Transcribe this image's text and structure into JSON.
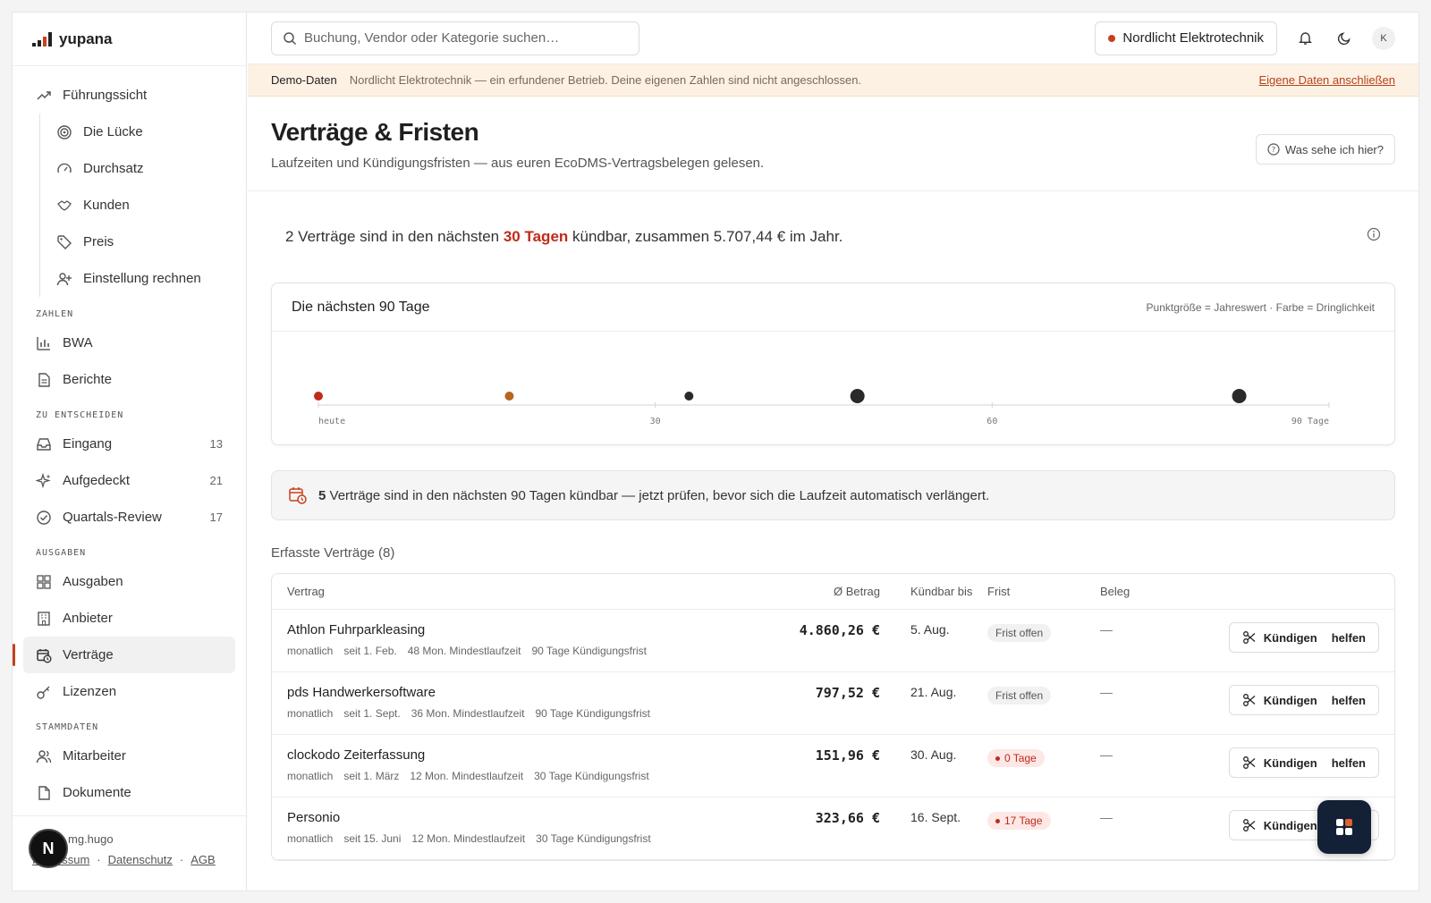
{
  "brand": {
    "name": "yupana"
  },
  "sidebar": {
    "top_items": [
      {
        "label": "Führungssicht",
        "icon": "trend-up-icon"
      }
    ],
    "sub_items": [
      {
        "label": "Die Lücke",
        "icon": "target-icon"
      },
      {
        "label": "Durchsatz",
        "icon": "gauge-icon"
      },
      {
        "label": "Kunden",
        "icon": "handshake-icon"
      },
      {
        "label": "Preis",
        "icon": "tag-icon"
      },
      {
        "label": "Einstellung rechnen",
        "icon": "user-plus-icon"
      }
    ],
    "sections": [
      {
        "title": "ZAHLEN",
        "items": [
          {
            "label": "BWA",
            "icon": "bar-chart-icon",
            "count": ""
          },
          {
            "label": "Berichte",
            "icon": "document-icon",
            "count": ""
          }
        ]
      },
      {
        "title": "ZU ENTSCHEIDEN",
        "items": [
          {
            "label": "Eingang",
            "icon": "inbox-icon",
            "count": "13"
          },
          {
            "label": "Aufgedeckt",
            "icon": "sparkles-icon",
            "count": "21"
          },
          {
            "label": "Quartals-Review",
            "icon": "check-circle-icon",
            "count": "17"
          }
        ]
      },
      {
        "title": "AUSGABEN",
        "items": [
          {
            "label": "Ausgaben",
            "icon": "grid-icon",
            "count": ""
          },
          {
            "label": "Anbieter",
            "icon": "building-icon",
            "count": ""
          },
          {
            "label": "Verträge",
            "icon": "calendar-clock-icon",
            "count": "",
            "active": true
          },
          {
            "label": "Lizenzen",
            "icon": "key-icon",
            "count": ""
          }
        ]
      },
      {
        "title": "STAMMDATEN",
        "items": [
          {
            "label": "Mitarbeiter",
            "icon": "users-icon",
            "count": ""
          },
          {
            "label": "Dokumente",
            "icon": "file-icon",
            "count": ""
          }
        ]
      }
    ],
    "footer": {
      "user": "mg.hugo",
      "links": [
        "Impressum",
        "Datenschutz",
        "AGB"
      ],
      "avatar_letter": "N"
    }
  },
  "topbar": {
    "search_placeholder": "Buchung, Vendor oder Kategorie suchen…",
    "company": "Nordlicht Elektrotechnik",
    "avatar": "K"
  },
  "banner": {
    "label": "Demo-Daten",
    "text": "Nordlicht Elektrotechnik — ein erfundener Betrieb. Deine eigenen Zahlen sind nicht angeschlossen.",
    "link": "Eigene Daten anschließen"
  },
  "page": {
    "title": "Verträge & Fristen",
    "subtitle": "Laufzeiten und Kündigungsfristen — aus euren EcoDMS-Vertragsbelegen gelesen.",
    "help": "Was sehe ich hier?"
  },
  "summary": {
    "prefix": "2 Verträge sind in den nächsten ",
    "highlight": "30 Tagen",
    "suffix": " kündbar, zusammen 5.707,44 € im Jahr."
  },
  "chart_data": {
    "type": "scatter",
    "title": "Die nächsten 90 Tage",
    "legend": "Punktgröße = Jahreswert · Farbe = Dringlichkeit",
    "x_ticks": [
      {
        "value": 0,
        "label": "heute"
      },
      {
        "value": 30,
        "label": "30"
      },
      {
        "value": 60,
        "label": "60"
      },
      {
        "value": 90,
        "label": "90 Tage"
      }
    ],
    "xlim": [
      0,
      90
    ],
    "points": [
      {
        "x": 0,
        "size": 1,
        "color": "#c02a1a"
      },
      {
        "x": 17,
        "size": 1,
        "color": "#b8651e"
      },
      {
        "x": 33,
        "size": 1,
        "color": "#2a2a2a"
      },
      {
        "x": 48,
        "size": 1.6,
        "color": "#2a2a2a"
      },
      {
        "x": 82,
        "size": 1.6,
        "color": "#2a2a2a"
      }
    ]
  },
  "alert": {
    "count": "5",
    "text": " Verträge sind in den nächsten 90 Tagen kündbar — jetzt prüfen, bevor sich die Laufzeit automatisch verlängert."
  },
  "table": {
    "title": "Erfasste Verträge (8)",
    "columns": [
      "Vertrag",
      "Ø Betrag",
      "Kündbar bis",
      "Frist",
      "Beleg"
    ],
    "action_label": "Kündigen",
    "action_label2": "helfen",
    "rows": [
      {
        "name": "Athlon Fuhrparkleasing",
        "meta": [
          "monatlich",
          "seit 1. Feb.",
          "48 Mon. Mindestlaufzeit",
          "90 Tage Kündigungsfrist"
        ],
        "amount": "4.860,26 €",
        "date": "5. Aug.",
        "frist": "Frist offen",
        "urgent": false,
        "beleg": "—"
      },
      {
        "name": "pds Handwerkersoftware",
        "meta": [
          "monatlich",
          "seit 1. Sept.",
          "36 Mon. Mindestlaufzeit",
          "90 Tage Kündigungsfrist"
        ],
        "amount": "797,52 €",
        "date": "21. Aug.",
        "frist": "Frist offen",
        "urgent": false,
        "beleg": "—"
      },
      {
        "name": "clockodo Zeiterfassung",
        "meta": [
          "monatlich",
          "seit 1. März",
          "12 Mon. Mindestlaufzeit",
          "30 Tage Kündigungsfrist"
        ],
        "amount": "151,96 €",
        "date": "30. Aug.",
        "frist": "0 Tage",
        "urgent": true,
        "beleg": "—"
      },
      {
        "name": "Personio",
        "meta": [
          "monatlich",
          "seit 15. Juni",
          "12 Mon. Mindestlaufzeit",
          "30 Tage Kündigungsfrist"
        ],
        "amount": "323,66 €",
        "date": "16. Sept.",
        "frist": "17 Tage",
        "urgent": true,
        "beleg": "—"
      }
    ]
  }
}
